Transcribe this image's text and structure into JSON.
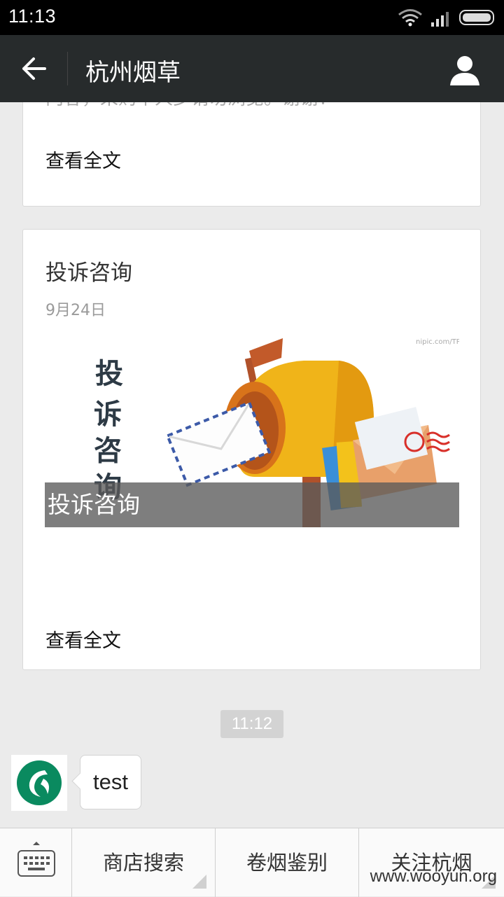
{
  "status_bar": {
    "time": "11:13"
  },
  "header": {
    "title": "杭州烟草"
  },
  "feed": {
    "card1": {
      "clipped_text": "内容，采购个人步请勿浏览。谢谢！",
      "read_more": "查看全文"
    },
    "card2": {
      "title": "投诉咨询",
      "date": "9月24日",
      "image_caption": "投诉咨询",
      "image_vertical_text": "投诉咨询",
      "image_site_mark": "nipic.com/TP",
      "read_more": "查看全文"
    },
    "time_divider": "11:12",
    "message": {
      "text": "test"
    }
  },
  "menu": {
    "items": [
      {
        "label": "商店搜索"
      },
      {
        "label": "卷烟鉴别"
      },
      {
        "label": "关注杭烟"
      }
    ]
  },
  "watermark": "www.wooyun.org",
  "colors": {
    "header_bg": "#272b2c",
    "status_bg": "#000000",
    "page_bg": "#ebebeb",
    "brand_green": "#0a8a5f"
  }
}
